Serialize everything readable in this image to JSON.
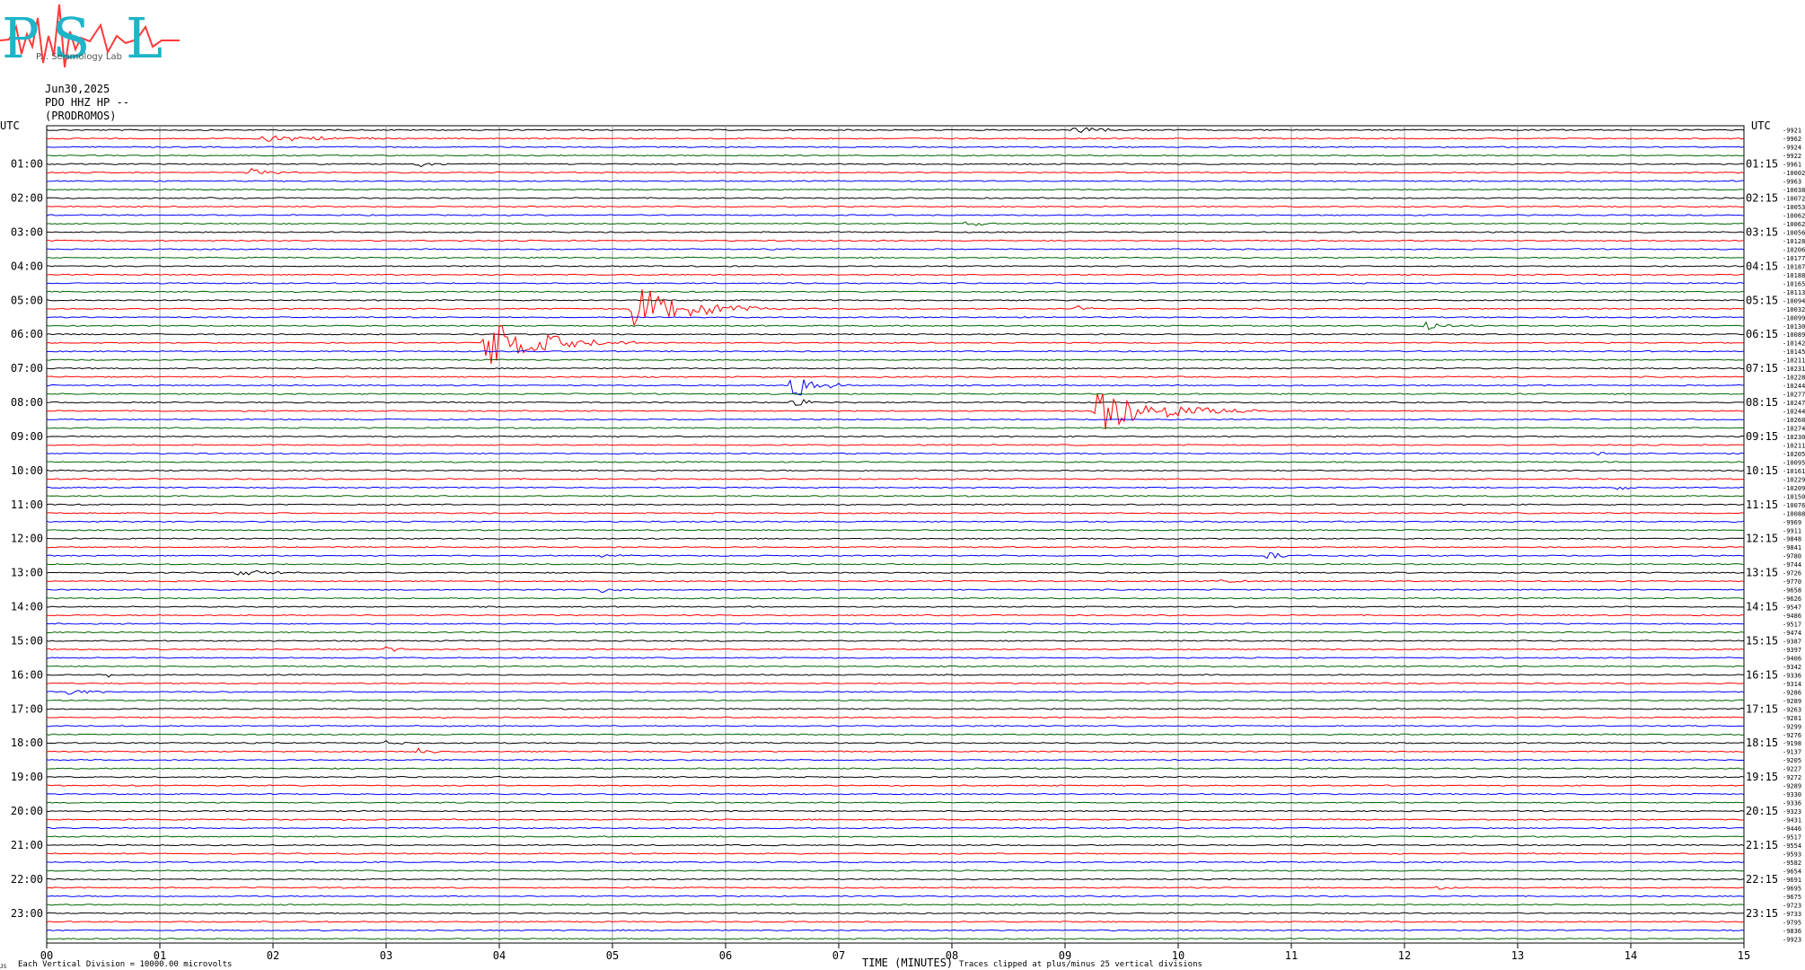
{
  "logo": {
    "letters": "PSL",
    "subtext": "P... Seismology Lab",
    "colors": {
      "letters": "#1fb4c8",
      "trace": "#ff3b3b"
    }
  },
  "header": {
    "date": "Jun30,2025",
    "station": "PDO HHZ HP --",
    "site": "(PRODROMOS)"
  },
  "axes": {
    "left_utc": "UTC",
    "right_utc": "UTC",
    "xlabel": "TIME (MINUTES)",
    "xticks": [
      "00",
      "01",
      "02",
      "03",
      "04",
      "05",
      "06",
      "07",
      "08",
      "09",
      "10",
      "11",
      "12",
      "13",
      "14",
      "15"
    ],
    "left_hours": [
      "01:00",
      "02:00",
      "03:00",
      "04:00",
      "05:00",
      "06:00",
      "07:00",
      "08:00",
      "09:00",
      "10:00",
      "11:00",
      "12:00",
      "13:00",
      "14:00",
      "15:00",
      "16:00",
      "17:00",
      "18:00",
      "19:00",
      "20:00",
      "21:00",
      "22:00",
      "23:00"
    ],
    "right_hours": [
      "01:15",
      "02:15",
      "03:15",
      "04:15",
      "05:15",
      "06:15",
      "07:15",
      "08:15",
      "09:15",
      "10:15",
      "11:15",
      "12:15",
      "13:15",
      "14:15",
      "15:15",
      "16:15",
      "17:15",
      "18:15",
      "19:15",
      "20:15",
      "21:15",
      "22:15",
      "23:15"
    ]
  },
  "footer": {
    "scale_note": "Each Vertical Division = 10000.00 microvolts",
    "clip_note": "Traces clipped at plus/minus 25 vertical divisions",
    "corner": "JS"
  },
  "chart_data": {
    "type": "line",
    "title": "PDO HHZ HP -- (PRODROMOS) Jun30,2025",
    "xlabel": "TIME (MINUTES)",
    "xlim": [
      0,
      15
    ],
    "colors": [
      "#000000",
      "#ff0000",
      "#0000ff",
      "#006400"
    ],
    "row_offsets": [
      "-9921",
      "-9962",
      "-9924",
      "-9922",
      "-9961",
      "-10002",
      "-9963",
      "-10038",
      "-10072",
      "-10053",
      "-10062",
      "-10062",
      "-10056",
      "-10128",
      "-10206",
      "-10177",
      "-10187",
      "-10188",
      "-10165",
      "-10113",
      "-10094",
      "-10032",
      "-10099",
      "-10130",
      "-10089",
      "-10142",
      "-10145",
      "-10211",
      "-10231",
      "-10228",
      "-10244",
      "-10277",
      "-10247",
      "-10244",
      "-10268",
      "-10274",
      "-10230",
      "-10211",
      "-10205",
      "-10095",
      "-10161",
      "-10229",
      "-10209",
      "-10150",
      "-10076",
      "-10088",
      "-9969",
      "-9911",
      "-9848",
      "-9841",
      "-9780",
      "-9744",
      "-9726",
      "-9770",
      "-9658",
      "-9626",
      "-9547",
      "-9486",
      "-9517",
      "-9474",
      "-9387",
      "-9397",
      "-9406",
      "-9342",
      "-9336",
      "-9314",
      "-9286",
      "-9289",
      "-9263",
      "-9281",
      "-9299",
      "-9276",
      "-9198",
      "-9137",
      "-9205",
      "-9227",
      "-9272",
      "-9289",
      "-9330",
      "-9336",
      "-9323",
      "-9431",
      "-9446",
      "-9517",
      "-9554",
      "-9593",
      "-9582",
      "-9654",
      "-9691",
      "-9695",
      "-9675",
      "-9723",
      "-9733",
      "-9795",
      "-9836",
      "-9923"
    ],
    "events": [
      {
        "row": 0,
        "minute": 9.1,
        "amplitude": 0.4,
        "duration": 0.7
      },
      {
        "row": 1,
        "minute": 1.9,
        "amplitude": 0.5,
        "duration": 1.5
      },
      {
        "row": 4,
        "minute": 3.3,
        "amplitude": 0.4,
        "duration": 0.3
      },
      {
        "row": 5,
        "minute": 1.8,
        "amplitude": 0.6,
        "duration": 0.5
      },
      {
        "row": 11,
        "minute": 8.1,
        "amplitude": 0.4,
        "duration": 0.5
      },
      {
        "row": 21,
        "minute": 5.2,
        "amplitude": 3.0,
        "duration": 1.3
      },
      {
        "row": 21,
        "minute": 9.1,
        "amplitude": 0.4,
        "duration": 0.4
      },
      {
        "row": 23,
        "minute": 12.2,
        "amplitude": 0.6,
        "duration": 0.5
      },
      {
        "row": 25,
        "minute": 3.9,
        "amplitude": 3.0,
        "duration": 1.3
      },
      {
        "row": 30,
        "minute": 6.6,
        "amplitude": 1.8,
        "duration": 0.6
      },
      {
        "row": 32,
        "minute": 6.6,
        "amplitude": 0.5,
        "duration": 0.6
      },
      {
        "row": 33,
        "minute": 9.3,
        "amplitude": 3.0,
        "duration": 1.4
      },
      {
        "row": 38,
        "minute": 13.7,
        "amplitude": 0.4,
        "duration": 0.4
      },
      {
        "row": 42,
        "minute": 13.9,
        "amplitude": 0.4,
        "duration": 0.3
      },
      {
        "row": 50,
        "minute": 10.8,
        "amplitude": 0.4,
        "duration": 0.4
      },
      {
        "row": 50,
        "minute": 4.9,
        "amplitude": 0.4,
        "duration": 0.4
      },
      {
        "row": 52,
        "minute": 1.7,
        "amplitude": 0.5,
        "duration": 0.6
      },
      {
        "row": 53,
        "minute": 10.4,
        "amplitude": 0.4,
        "duration": 0.3
      },
      {
        "row": 54,
        "minute": 4.9,
        "amplitude": 0.4,
        "duration": 0.4
      },
      {
        "row": 61,
        "minute": 3.0,
        "amplitude": 0.4,
        "duration": 0.3
      },
      {
        "row": 64,
        "minute": 0.5,
        "amplitude": 0.4,
        "duration": 0.3
      },
      {
        "row": 66,
        "minute": 0.2,
        "amplitude": 0.6,
        "duration": 0.4
      },
      {
        "row": 72,
        "minute": 3.0,
        "amplitude": 0.4,
        "duration": 0.3
      },
      {
        "row": 73,
        "minute": 3.3,
        "amplitude": 0.6,
        "duration": 0.3
      },
      {
        "row": 89,
        "minute": 12.3,
        "amplitude": 0.3,
        "duration": 0.4
      }
    ]
  }
}
